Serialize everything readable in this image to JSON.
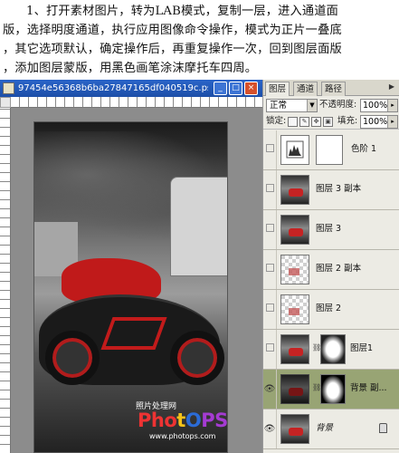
{
  "instructions": {
    "lines": [
      "1、打开素材图片，转为LAB模式，复制一层，进入通道面",
      "版，选择明度通道，执行应用图像命令操作，模式为正片一叠底",
      "，其它选项默认，确定操作后，再重复操作一次，回到图层面版",
      "，添加图层蒙版，用黑色画笔涂沫摩托车四周。"
    ]
  },
  "document": {
    "title": "97454e56368b6ba27847165df040519c.ps...",
    "minimize": "_",
    "maximize": "□",
    "close": "×",
    "watermark_top": "照片处理网",
    "watermark_logo": [
      "Pho",
      "t",
      "O",
      "PS"
    ],
    "watermark_url": "www.photops.com"
  },
  "layers_panel": {
    "tabs": [
      "图层",
      "通道",
      "路径"
    ],
    "active_tab": "图层",
    "blend_mode": "正常",
    "opacity_label": "不透明度:",
    "opacity_value": "100%",
    "lock_label": "锁定:",
    "fill_label": "填充:",
    "fill_value": "100%",
    "layers": [
      {
        "name": "色阶 1",
        "visible": false,
        "selected": false
      },
      {
        "name": "图层 3 副本",
        "visible": false,
        "selected": false
      },
      {
        "name": "图层 3",
        "visible": false,
        "selected": false
      },
      {
        "name": "图层 2 副本",
        "visible": false,
        "selected": false
      },
      {
        "name": "图层 2",
        "visible": false,
        "selected": false
      },
      {
        "name": "图层1",
        "visible": false,
        "selected": false
      },
      {
        "name": "背景 副...",
        "visible": true,
        "selected": true
      },
      {
        "name": "背景",
        "visible": true,
        "selected": false
      }
    ]
  },
  "colors": {
    "selected_layer": "#98a474",
    "titlebar": "#2a64c8"
  }
}
